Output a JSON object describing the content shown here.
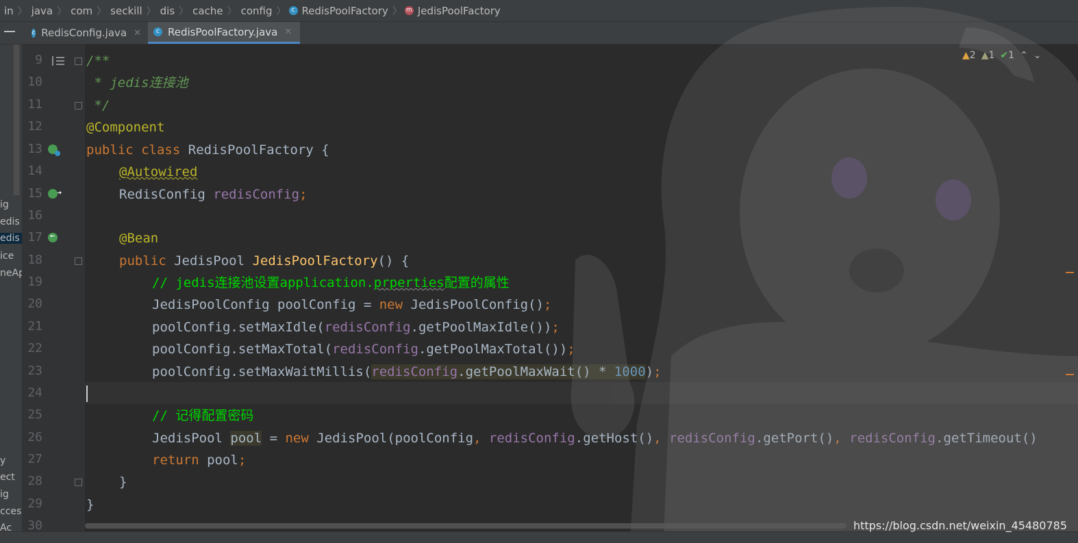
{
  "breadcrumb": {
    "items": [
      "in",
      "java",
      "com",
      "seckill",
      "dis",
      "cache",
      "config"
    ],
    "class_item": "RedisPoolFactory",
    "method_item": "JedisPoolFactory"
  },
  "tabs": [
    {
      "label": "RedisConfig.java",
      "active": false
    },
    {
      "label": "RedisPoolFactory.java",
      "active": true
    }
  ],
  "left_panel": {
    "labels": [
      "ig",
      "edis",
      "edis",
      "ice",
      "neAp",
      "y",
      "ect",
      "ig",
      "cces",
      "Ac"
    ]
  },
  "gutter": {
    "line_numbers": [
      "9",
      "10",
      "11",
      "12",
      "13",
      "14",
      "15",
      "16",
      "17",
      "18",
      "19",
      "20",
      "21",
      "22",
      "23",
      "24",
      "25",
      "26",
      "27",
      "28",
      "29",
      "30"
    ]
  },
  "code": {
    "l9": "/**",
    "l10": " * jedis连接池",
    "l11": " */",
    "l12": "@Component",
    "l13_kw1": "public",
    "l13_kw2": "class",
    "l13_name": "RedisPoolFactory {",
    "l14": "@Autowired",
    "l15_type": "RedisConfig ",
    "l15_field": "redisConfig",
    "l15_semi": ";",
    "l17": "@Bean",
    "l18_kw": "public",
    "l18_type": " JedisPool ",
    "l18_method": "JedisPoolFactory",
    "l18_rest": "() {",
    "l19_a": "// jedis连接池设置application.",
    "l19_b": "prperties",
    "l19_c": "配置的属性",
    "l20_a": "JedisPoolConfig poolConfig = ",
    "l20_kw": "new",
    "l20_b": " JedisPoolConfig()",
    "l20_semi": ";",
    "l21_a": "poolConfig.setMaxIdle(",
    "l21_field": "redisConfig",
    "l21_b": ".getPoolMaxIdle())",
    "l21_semi": ";",
    "l22_a": "poolConfig.setMaxTotal(",
    "l22_field": "redisConfig",
    "l22_b": ".getPoolMaxTotal())",
    "l22_semi": ";",
    "l23_a": "poolConfig.setMaxWaitMillis(",
    "l23_field": "redisConfig",
    "l23_b": ".getPoolMaxWait() * ",
    "l23_num": "1000",
    "l23_c": ")",
    "l23_semi": ";",
    "l25": "// 记得配置密码",
    "l26_a": "JedisPool ",
    "l26_var": "pool",
    "l26_b": " = ",
    "l26_kw": "new",
    "l26_c": " JedisPool(poolConfig",
    "l26_comma1": ", ",
    "l26_f1": "redisConfig",
    "l26_d": ".getHost()",
    "l26_comma2": ", ",
    "l26_f2": "redisConfig",
    "l26_e": ".getPort()",
    "l26_comma3": ", ",
    "l26_f3": "redisConfig",
    "l26_f": ".getTimeout()",
    "l27_kw": "return",
    "l27_b": " pool",
    "l27_semi": ";",
    "l28": "}",
    "l29": "}"
  },
  "inspections": {
    "warnings": "2",
    "weak_warnings": "1",
    "typos": "1"
  },
  "watermark": "https://blog.csdn.net/weixin_45480785",
  "colors": {
    "keyword": "#cc7832",
    "annotation": "#bbb529",
    "field": "#9876aa",
    "method": "#ffc66d",
    "number": "#6897bb",
    "comment": "#629755"
  }
}
